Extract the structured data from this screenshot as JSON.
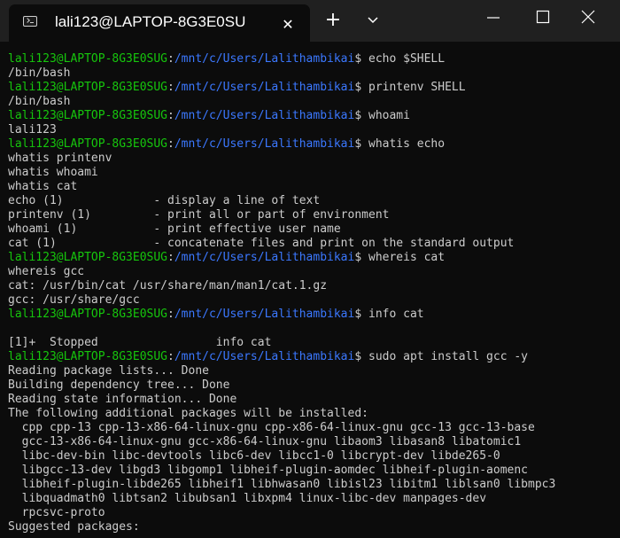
{
  "window": {
    "tab_title": "lali123@LAPTOP-8G3E0SU",
    "tab_close_glyph": "✕",
    "new_tab_glyph": "+",
    "icons": [
      "terminal-icon",
      "close-icon",
      "plus-icon",
      "chevron-down-icon",
      "minimize-icon",
      "maximize-icon",
      "close-window-icon"
    ]
  },
  "colors": {
    "prompt_user": "#16c60c",
    "prompt_path": "#3b78ff",
    "text": "#cccccc",
    "background": "#0c0c0c",
    "titlebar": "#202020"
  },
  "terminal": {
    "lines": [
      {
        "type": "prompt",
        "user": "lali123@LAPTOP-8G3E0SUG",
        "sep": ":",
        "path": "/mnt/c/Users/Lalithambikai",
        "cmd": "$ echo $SHELL"
      },
      {
        "type": "output",
        "text": "/bin/bash"
      },
      {
        "type": "prompt",
        "user": "lali123@LAPTOP-8G3E0SUG",
        "sep": ":",
        "path": "/mnt/c/Users/Lalithambikai",
        "cmd": "$ printenv SHELL"
      },
      {
        "type": "output",
        "text": "/bin/bash"
      },
      {
        "type": "prompt",
        "user": "lali123@LAPTOP-8G3E0SUG",
        "sep": ":",
        "path": "/mnt/c/Users/Lalithambikai",
        "cmd": "$ whoami"
      },
      {
        "type": "output",
        "text": "lali123"
      },
      {
        "type": "prompt",
        "user": "lali123@LAPTOP-8G3E0SUG",
        "sep": ":",
        "path": "/mnt/c/Users/Lalithambikai",
        "cmd": "$ whatis echo"
      },
      {
        "type": "output",
        "text": "whatis printenv"
      },
      {
        "type": "output",
        "text": "whatis whoami"
      },
      {
        "type": "output",
        "text": "whatis cat"
      },
      {
        "type": "output",
        "text": "echo (1)             - display a line of text"
      },
      {
        "type": "output",
        "text": "printenv (1)         - print all or part of environment"
      },
      {
        "type": "output",
        "text": "whoami (1)           - print effective user name"
      },
      {
        "type": "output",
        "text": "cat (1)              - concatenate files and print on the standard output"
      },
      {
        "type": "prompt",
        "user": "lali123@LAPTOP-8G3E0SUG",
        "sep": ":",
        "path": "/mnt/c/Users/Lalithambikai",
        "cmd": "$ whereis cat"
      },
      {
        "type": "output",
        "text": "whereis gcc"
      },
      {
        "type": "output",
        "text": "cat: /usr/bin/cat /usr/share/man/man1/cat.1.gz"
      },
      {
        "type": "output",
        "text": "gcc: /usr/share/gcc"
      },
      {
        "type": "prompt",
        "user": "lali123@LAPTOP-8G3E0SUG",
        "sep": ":",
        "path": "/mnt/c/Users/Lalithambikai",
        "cmd": "$ info cat"
      },
      {
        "type": "output",
        "text": ""
      },
      {
        "type": "output",
        "text": "[1]+  Stopped                 info cat"
      },
      {
        "type": "prompt",
        "user": "lali123@LAPTOP-8G3E0SUG",
        "sep": ":",
        "path": "/mnt/c/Users/Lalithambikai",
        "cmd": "$ sudo apt install gcc -y"
      },
      {
        "type": "output",
        "text": "Reading package lists... Done"
      },
      {
        "type": "output",
        "text": "Building dependency tree... Done"
      },
      {
        "type": "output",
        "text": "Reading state information... Done"
      },
      {
        "type": "output",
        "text": "The following additional packages will be installed:"
      },
      {
        "type": "output",
        "text": "  cpp cpp-13 cpp-13-x86-64-linux-gnu cpp-x86-64-linux-gnu gcc-13 gcc-13-base"
      },
      {
        "type": "output",
        "text": "  gcc-13-x86-64-linux-gnu gcc-x86-64-linux-gnu libaom3 libasan8 libatomic1"
      },
      {
        "type": "output",
        "text": "  libc-dev-bin libc-devtools libc6-dev libcc1-0 libcrypt-dev libde265-0"
      },
      {
        "type": "output",
        "text": "  libgcc-13-dev libgd3 libgomp1 libheif-plugin-aomdec libheif-plugin-aomenc"
      },
      {
        "type": "output",
        "text": "  libheif-plugin-libde265 libheif1 libhwasan0 libisl23 libitm1 liblsan0 libmpc3"
      },
      {
        "type": "output",
        "text": "  libquadmath0 libtsan2 libubsan1 libxpm4 linux-libc-dev manpages-dev"
      },
      {
        "type": "output",
        "text": "  rpcsvc-proto"
      },
      {
        "type": "output",
        "text": "Suggested packages:"
      }
    ]
  }
}
